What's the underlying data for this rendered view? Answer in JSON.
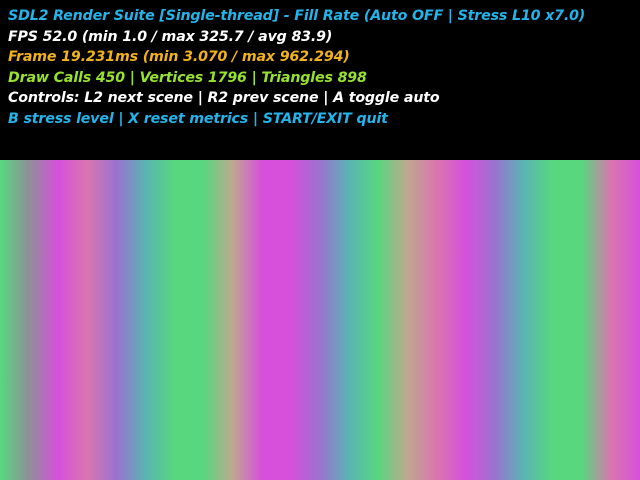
{
  "window": {
    "background": "#000000"
  },
  "hud": {
    "lines": [
      {
        "text": "SDL2 Render Suite [Single-thread] - Fill Rate (Auto OFF | Stress L10 x7.0)",
        "color": "#22b4ea"
      },
      {
        "text": "FPS 52.0 (min 1.0 / max 325.7 / avg 83.9)",
        "color": "#ffffff"
      },
      {
        "text": "Frame 19.231ms (min 3.070 / max 962.294)",
        "color": "#f2b21c"
      },
      {
        "text": "Draw Calls 450 | Vertices 1796 | Triangles 898",
        "color": "#97e22b"
      },
      {
        "text": "Controls: L2 next scene | R2 prev scene | A toggle auto",
        "color": "#ffffff"
      },
      {
        "text": "B stress level | X reset metrics | START/EXIT quit",
        "color": "#22b4ea"
      }
    ]
  },
  "fill_scene": {
    "pattern": "vertical-color-bands",
    "colors": {
      "green": "#58d77f",
      "magenta": "#d650dc",
      "pink": "#da76ae",
      "gray": "#8f8f98",
      "purple": "#9b72cf",
      "teal": "#5ab4b3",
      "tan": "#bfa88f"
    },
    "band_sequence": [
      "green",
      "gray",
      "magenta",
      "pink",
      "purple",
      "teal",
      "green",
      "green",
      "tan",
      "magenta",
      "magenta",
      "purple",
      "teal",
      "green",
      "tan",
      "pink",
      "magenta",
      "purple",
      "teal",
      "green",
      "green",
      "pink",
      "magenta"
    ]
  }
}
